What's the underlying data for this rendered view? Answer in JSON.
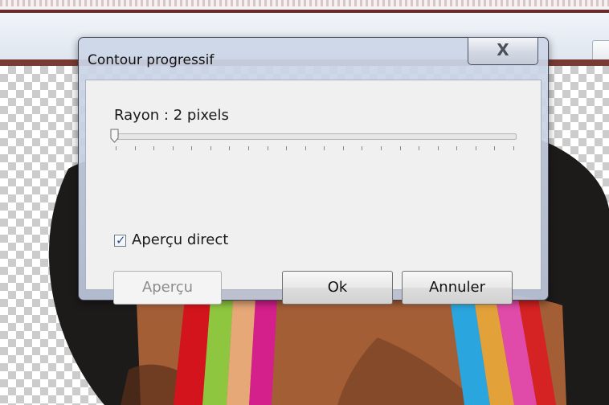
{
  "dialog": {
    "title": "Contour progressif",
    "close_symbol": "X",
    "radius": {
      "label": "Rayon : 2 pixels",
      "value": 2,
      "unit": "pixels"
    },
    "slider": {
      "fraction": 0.0,
      "tick_count": 22
    },
    "live_preview": {
      "label": "Aperçu direct",
      "checked": true
    },
    "buttons": {
      "preview": "Aperçu",
      "ok": "Ok",
      "cancel": "Annuler"
    }
  },
  "colors": {
    "accent_dark_red": "#6b2a2a",
    "dialog_frame": "#c6cfdf",
    "client_bg": "#f0f0f0",
    "checkbox_mark": "#2a4c9a"
  },
  "icons": {
    "close": "close-icon",
    "slider_thumb": "slider-thumb",
    "checkbox": "checkbox-check-icon"
  }
}
